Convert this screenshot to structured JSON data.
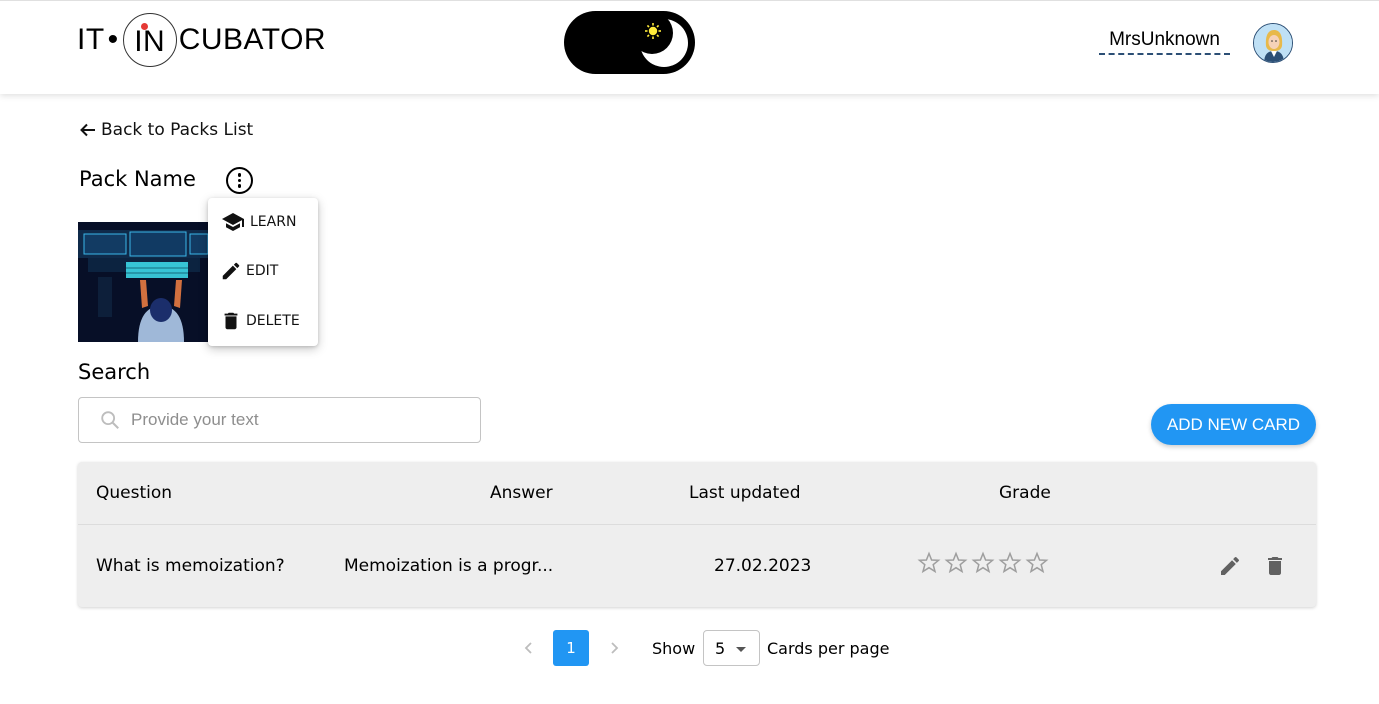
{
  "header": {
    "logo": {
      "part1": "IT",
      "dot": "•",
      "part2": "IN",
      "part3": "CUBATOR"
    },
    "theme_toggle_icon": "moon-sun-icon",
    "username": "MrsUnknown",
    "avatar_icon": "avatar-woman-icon"
  },
  "nav": {
    "back_label": "Back to Packs List",
    "back_icon": "arrow-left-icon"
  },
  "pack": {
    "name": "Pack Name",
    "menu_icon": "more-vert-icon",
    "menu": [
      {
        "label": "LEARN",
        "icon": "school-icon"
      },
      {
        "label": "EDIT",
        "icon": "pencil-icon"
      },
      {
        "label": "DELETE",
        "icon": "trash-icon"
      }
    ]
  },
  "search": {
    "label": "Search",
    "placeholder": "Provide your text",
    "value": ""
  },
  "actions": {
    "add_card_label": "ADD NEW CARD"
  },
  "table": {
    "columns": [
      "Question",
      "Answer",
      "Last updated",
      "Grade"
    ],
    "rows": [
      {
        "question": "What is memoization?",
        "answer": "Memoization is a progr...",
        "last_updated": "27.02.2023",
        "grade": 0,
        "grade_max": 5
      }
    ]
  },
  "pagination": {
    "current_page": "1",
    "show_label": "Show",
    "page_size": "5",
    "per_page_label": "Cards per page"
  },
  "colors": {
    "accent": "#2196f3",
    "toggle_bg": "#000000",
    "sun": "#ffeb3b",
    "table_bg": "#eeeeee"
  }
}
